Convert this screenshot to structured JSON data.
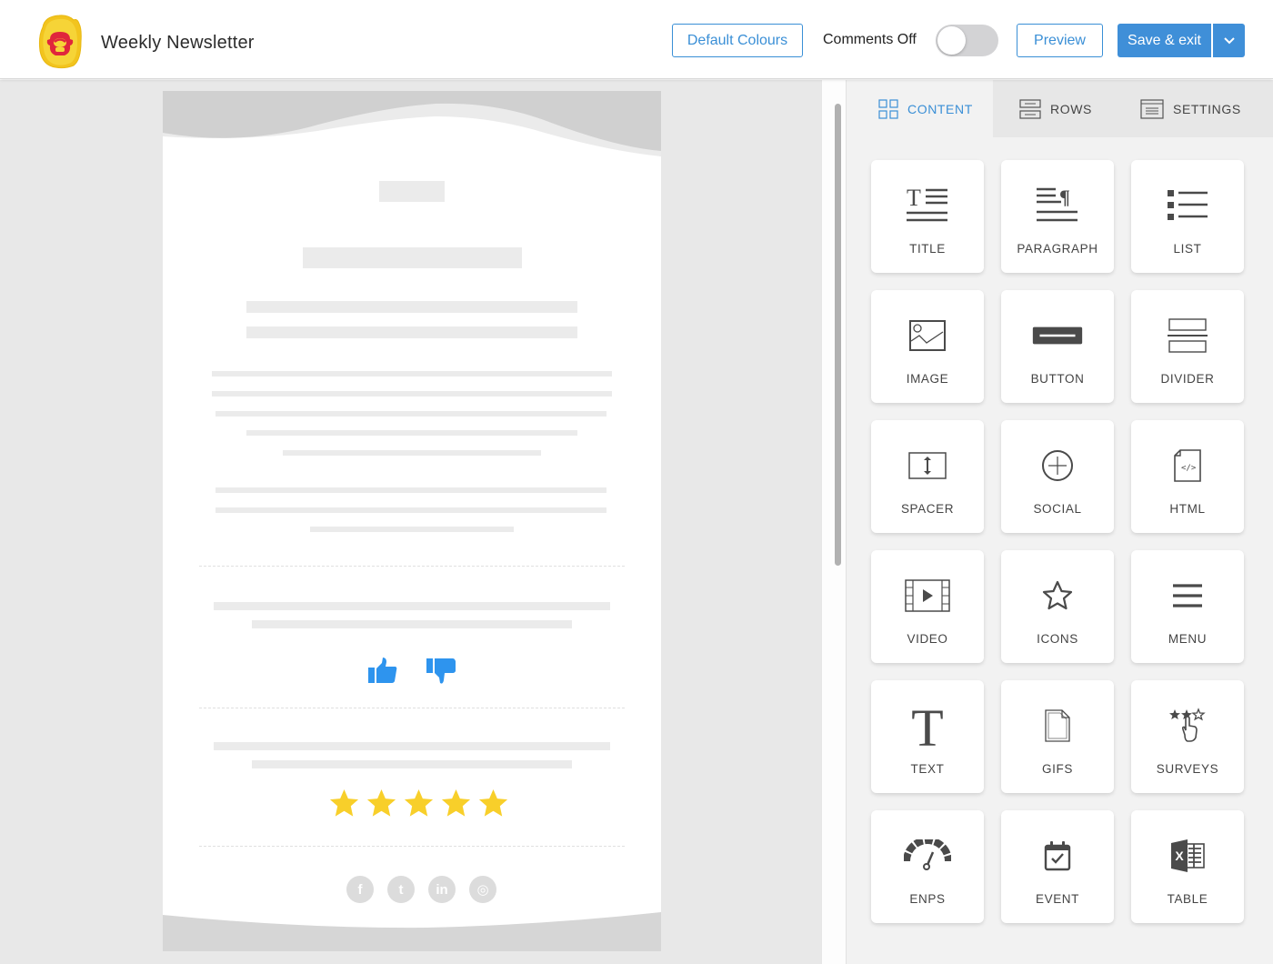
{
  "header": {
    "app_title": "Weekly Newsletter",
    "default_colours_label": "Default Colours",
    "comments_label": "Comments Off",
    "comments_toggle_on": false,
    "preview_label": "Preview",
    "save_label": "Save & exit"
  },
  "colors": {
    "accent": "#3f8fd8",
    "logo_yellow": "#f5d12e",
    "logo_red": "#e0263c",
    "thumb_blue": "#2e94ee",
    "star_yellow": "#f8cf2a"
  },
  "email_preview": {
    "feedback_icons": [
      "thumbs-up-icon",
      "thumbs-down-icon"
    ],
    "rating_stars": 5,
    "social_icons": [
      {
        "name": "facebook-icon",
        "glyph": "f"
      },
      {
        "name": "twitter-icon",
        "glyph": "t"
      },
      {
        "name": "linkedin-icon",
        "glyph": "in"
      },
      {
        "name": "instagram-icon",
        "glyph": "◎"
      }
    ]
  },
  "panel": {
    "tabs": [
      {
        "label": "CONTENT",
        "icon": "grid-icon",
        "active": true
      },
      {
        "label": "ROWS",
        "icon": "rows-icon",
        "active": false
      },
      {
        "label": "SETTINGS",
        "icon": "settings-icon",
        "active": false
      }
    ],
    "blocks": [
      {
        "label": "TITLE",
        "icon": "title-icon"
      },
      {
        "label": "PARAGRAPH",
        "icon": "paragraph-icon"
      },
      {
        "label": "LIST",
        "icon": "list-icon"
      },
      {
        "label": "IMAGE",
        "icon": "image-icon"
      },
      {
        "label": "BUTTON",
        "icon": "button-icon"
      },
      {
        "label": "DIVIDER",
        "icon": "divider-icon"
      },
      {
        "label": "SPACER",
        "icon": "spacer-icon"
      },
      {
        "label": "SOCIAL",
        "icon": "social-icon"
      },
      {
        "label": "HTML",
        "icon": "html-icon"
      },
      {
        "label": "VIDEO",
        "icon": "video-icon"
      },
      {
        "label": "ICONS",
        "icon": "star-icon"
      },
      {
        "label": "MENU",
        "icon": "menu-icon"
      },
      {
        "label": "TEXT",
        "icon": "text-icon"
      },
      {
        "label": "GIFS",
        "icon": "gifs-icon"
      },
      {
        "label": "SURVEYS",
        "icon": "surveys-icon"
      },
      {
        "label": "ENPS",
        "icon": "enps-gauge-icon"
      },
      {
        "label": "EVENT",
        "icon": "event-calendar-icon"
      },
      {
        "label": "TABLE",
        "icon": "table-excel-icon"
      }
    ]
  }
}
